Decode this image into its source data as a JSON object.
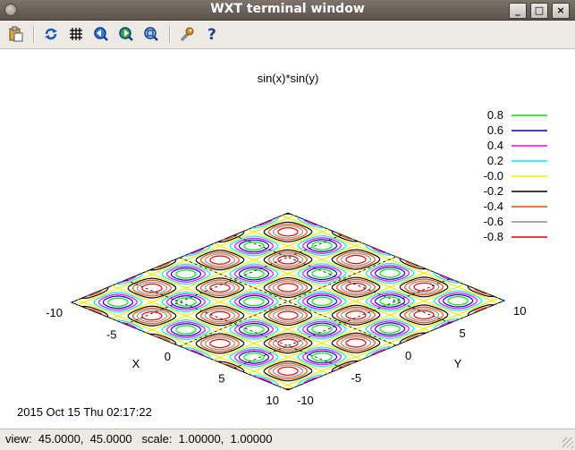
{
  "window": {
    "title": "WXT terminal window",
    "minimize_label": "_",
    "maximize_label": "□",
    "close_label": "×"
  },
  "toolbar": {
    "buttons": [
      {
        "name": "copy-to-clipboard-button",
        "icon": "clipboard-icon"
      },
      {
        "name": "replot-button",
        "icon": "refresh-icon"
      },
      {
        "name": "toggle-grid-button",
        "icon": "grid-icon"
      },
      {
        "name": "previous-zoom-button",
        "icon": "zoom-previous-icon"
      },
      {
        "name": "next-zoom-button",
        "icon": "zoom-next-icon"
      },
      {
        "name": "autoscale-button",
        "icon": "zoom-fit-icon"
      },
      {
        "name": "options-button",
        "icon": "wrench-icon"
      },
      {
        "name": "help-button",
        "icon": "help-icon"
      }
    ]
  },
  "plot": {
    "title": "sin(x)*sin(y)",
    "timestamp": "2015 Oct 15 Thu 02:17:22",
    "x_axis_label": "X",
    "y_axis_label": "Y",
    "x_ticks": [
      "-10",
      "-5",
      "0",
      "5",
      "10"
    ],
    "y_ticks": [
      "-10",
      "-5",
      "0",
      "5",
      "10"
    ]
  },
  "chart_data": {
    "type": "contour",
    "title": "sin(x)*sin(y)",
    "function": "sin(x)*sin(y)",
    "xlabel": "X",
    "ylabel": "Y",
    "xlim": [
      -10,
      10
    ],
    "ylim": [
      -10,
      10
    ],
    "view": [
      45,
      45
    ],
    "grid": true,
    "legend_position": "top-right",
    "levels": [
      {
        "label": "0.8",
        "value": 0.8,
        "color": "#00dd00"
      },
      {
        "label": "0.6",
        "value": 0.6,
        "color": "#0000cc"
      },
      {
        "label": "0.4",
        "value": 0.4,
        "color": "#ee00ee"
      },
      {
        "label": "0.2",
        "value": 0.2,
        "color": "#00eeee"
      },
      {
        "label": "-0.0",
        "value": 0.0,
        "color": "#eeee00"
      },
      {
        "label": "-0.2",
        "value": -0.2,
        "color": "#000000"
      },
      {
        "label": "-0.4",
        "value": -0.4,
        "color": "#e05000"
      },
      {
        "label": "-0.6",
        "value": -0.6,
        "color": "#909090"
      },
      {
        "label": "-0.8",
        "value": -0.8,
        "color": "#dd0000"
      }
    ]
  },
  "statusbar": {
    "text": "view:  45.0000,  45.0000   scale:  1.00000,  1.00000"
  }
}
